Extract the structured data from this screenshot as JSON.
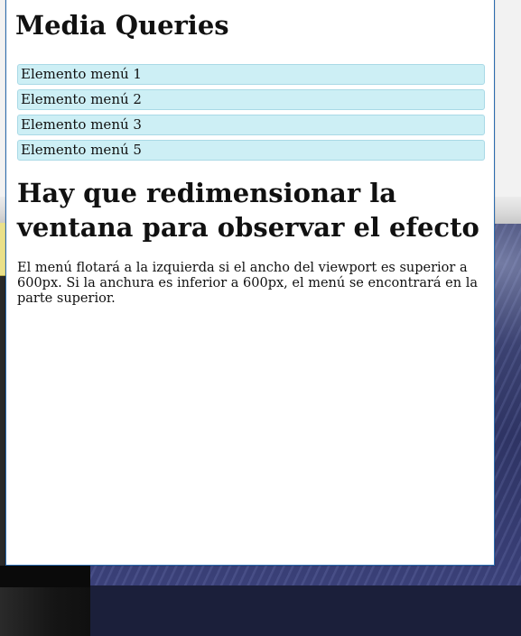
{
  "page": {
    "title": "Media Queries",
    "menu_items": [
      "Elemento menú 1",
      "Elemento menú 2",
      "Elemento menú 3",
      "Elemento menú 5"
    ],
    "heading": "Hay que redimensionar la ventana para observar el efecto",
    "description": "El menú flotará a la izquierda si el ancho del viewport es superior a 600px. Si la anchura es inferior a 600px, el menú se encontrará en la parte superior."
  },
  "colors": {
    "menu_item_background": "#cdeff5",
    "menu_item_border": "#a9d9e6",
    "window_border": "#2b6cb0"
  }
}
